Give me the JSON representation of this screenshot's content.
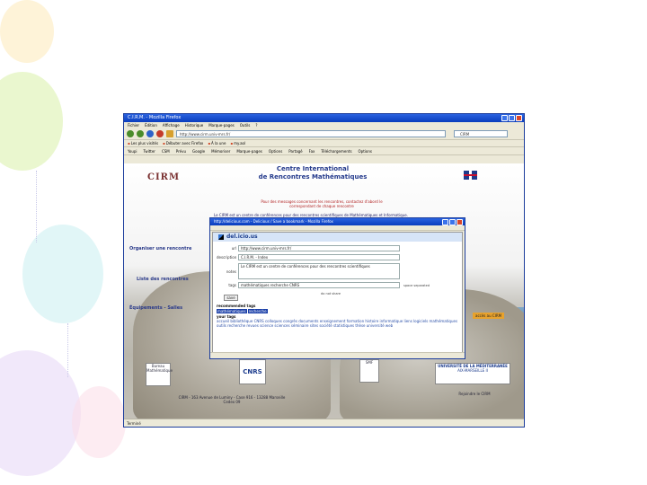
{
  "browser": {
    "title": "C.I.R.M. - Mozilla Firefox",
    "menu": [
      "Fichier",
      "Édition",
      "Affichage",
      "Historique",
      "Marque-pages",
      "Outils",
      "?"
    ],
    "url": "http://www.cirm.univ-mrs.fr/",
    "search_value": "CIRM",
    "bookmarks": [
      "Les plus visités",
      "Débuter avec Firefox",
      "À la une",
      "my.aol"
    ],
    "toolbar_items": [
      "Youpi",
      "Twitter",
      "CSM",
      "Prévu",
      "Google",
      "Mémoriser",
      "Marque-pages",
      "Options",
      "Partagé",
      "Fax",
      "Téléchargements",
      "Options"
    ],
    "status": "Terminé"
  },
  "webpage": {
    "logo_text": "CIRM",
    "title_line1": "Centre International",
    "title_line2": "de Rencontres Mathématiques",
    "red_note": "Pour des messages concernant les rencontres, contactez d'abord le",
    "red_note2": "correspondant de chaque rencontre",
    "intro": "Le CIRM est un centre de conférences pour des rencontres scientifiques de Mathématiques et Informatique.",
    "left_links": [
      "Organiser une rencontre",
      "Liste des rencontres",
      "Équipements - Salles"
    ],
    "partners": [
      "Bureau Mathématique",
      "CNRS",
      "SMF"
    ],
    "university": "UNIVERSITÉ DE LA MÉDITERRANÉE",
    "university_sub": "AIX-MARSEILLE II",
    "footer": "CIRM - 163 Avenue de Luminy - Case 916 - 13288 Marseille Cedex 09",
    "right_link": "accès au CIRM",
    "right_footer": "Rejoindre le CIRM"
  },
  "dialog": {
    "title": "http://delicious.com - Delicious / Save a bookmark - Mozilla Firefox",
    "brand": "del.icio.us",
    "fields": [
      {
        "label": "url",
        "value": "http://www.cirm.univ-mrs.fr/"
      },
      {
        "label": "description",
        "value": "C.I.R.M. - Index"
      },
      {
        "label": "notes",
        "value": "Le CIRM est un centre de conférences pour des rencontres scientifiques"
      },
      {
        "label": "tags",
        "value": "mathématiques recherche CNRS"
      }
    ],
    "tags_note": "space separated",
    "private_note": "do not share",
    "save_label": "save",
    "recommended_heading": "recommended tags",
    "recommended_tags": [
      "mathématiques",
      "recherche"
    ],
    "your_heading": "your tags",
    "your_tags": "accueil bibliothèque CNRS colloques congrès documents enseignement formation histoire informatique liens logiciels mathématiques outils recherche revues science sciences séminaire sites société statistiques thèse université web"
  }
}
